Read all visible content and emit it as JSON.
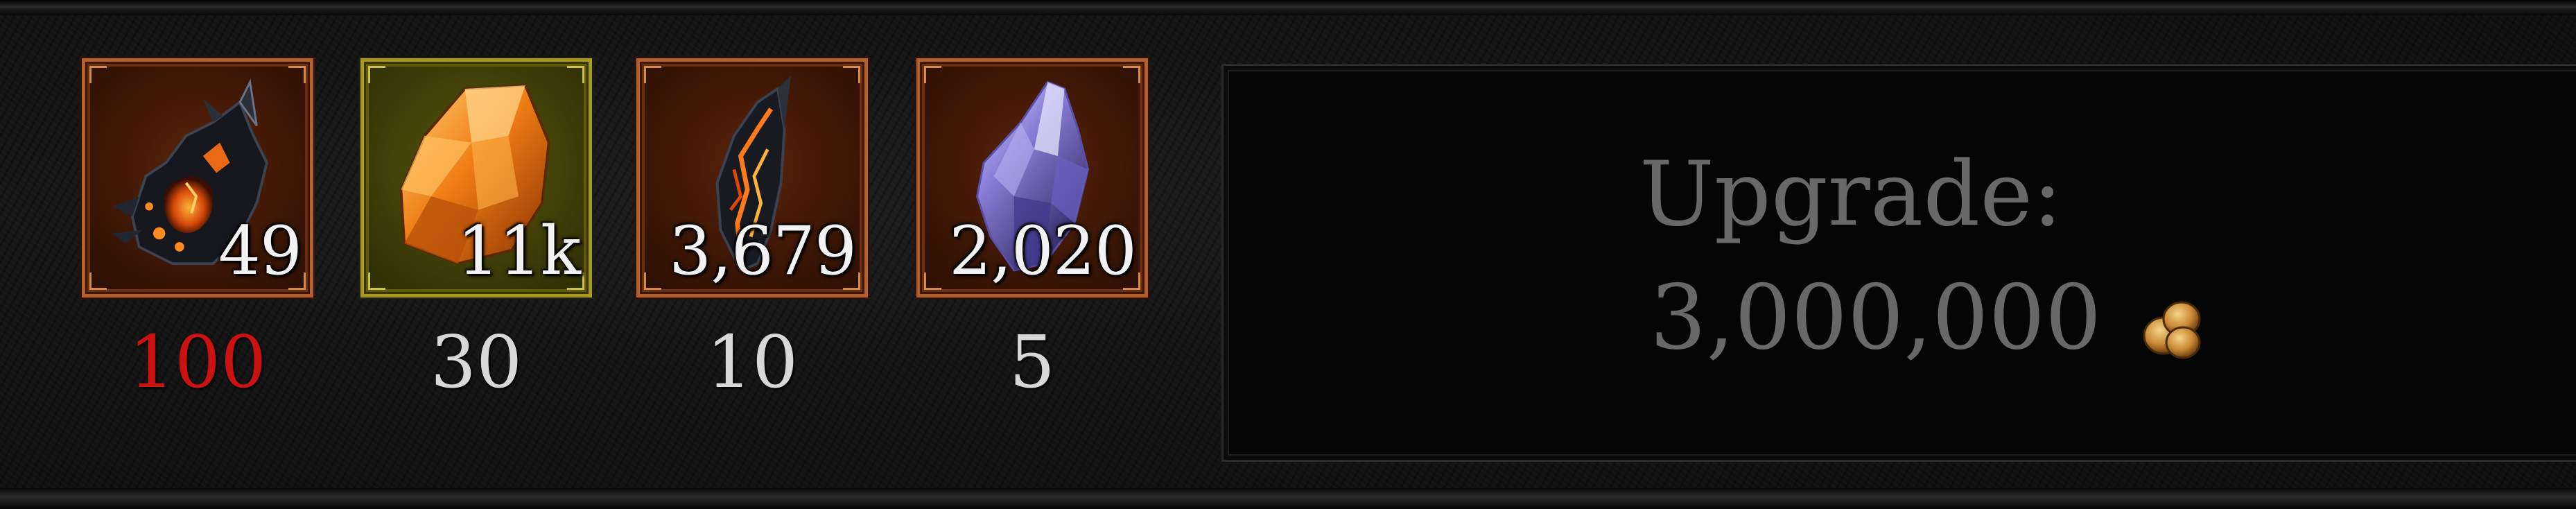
{
  "materials": [
    {
      "name": "obsidian-shard-icon",
      "owned": "49",
      "required": "100",
      "insufficient": true
    },
    {
      "name": "amber-crystal-icon",
      "owned": "11k",
      "required": "30",
      "insufficient": false
    },
    {
      "name": "ember-shard-icon",
      "owned": "3,679",
      "required": "10",
      "insufficient": false
    },
    {
      "name": "amethyst-crystal-icon",
      "owned": "2,020",
      "required": "5",
      "insufficient": false
    }
  ],
  "upgrade": {
    "title": "Upgrade:",
    "cost": "3,000,000",
    "currency_icon": "gold-coins-icon"
  },
  "colors": {
    "insufficient": "#cc1111",
    "normal_text": "#d8d8d8",
    "disabled_text": "#686868",
    "frame_bronze": "#b4602a",
    "frame_gold": "#a89a1e"
  }
}
